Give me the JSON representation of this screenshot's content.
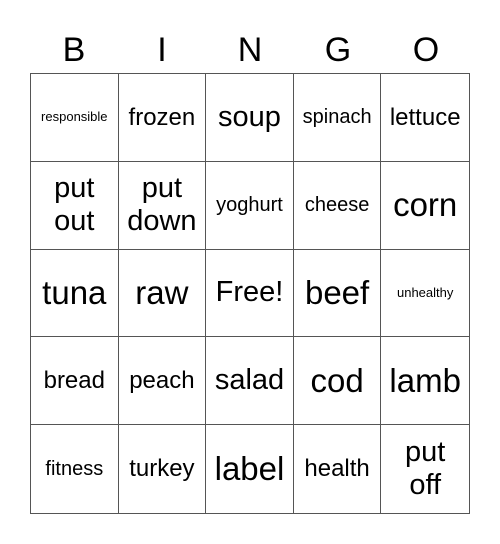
{
  "header": [
    "B",
    "I",
    "N",
    "G",
    "O"
  ],
  "cells": [
    {
      "text": "responsible",
      "size": "s-xs"
    },
    {
      "text": "frozen",
      "size": "s-m"
    },
    {
      "text": "soup",
      "size": "s-l"
    },
    {
      "text": "spinach",
      "size": "s-s"
    },
    {
      "text": "lettuce",
      "size": "s-m"
    },
    {
      "text": "put out",
      "size": "s-l"
    },
    {
      "text": "put down",
      "size": "s-l"
    },
    {
      "text": "yoghurt",
      "size": "s-s"
    },
    {
      "text": "cheese",
      "size": "s-s"
    },
    {
      "text": "corn",
      "size": "s-xl"
    },
    {
      "text": "tuna",
      "size": "s-xl"
    },
    {
      "text": "raw",
      "size": "s-xl"
    },
    {
      "text": "Free!",
      "size": "s-l"
    },
    {
      "text": "beef",
      "size": "s-xl"
    },
    {
      "text": "unhealthy",
      "size": "s-xs"
    },
    {
      "text": "bread",
      "size": "s-m"
    },
    {
      "text": "peach",
      "size": "s-m"
    },
    {
      "text": "salad",
      "size": "s-l"
    },
    {
      "text": "cod",
      "size": "s-xl"
    },
    {
      "text": "lamb",
      "size": "s-xl"
    },
    {
      "text": "fitness",
      "size": "s-s"
    },
    {
      "text": "turkey",
      "size": "s-m"
    },
    {
      "text": "label",
      "size": "s-xl"
    },
    {
      "text": "health",
      "size": "s-m"
    },
    {
      "text": "put off",
      "size": "s-l"
    }
  ]
}
